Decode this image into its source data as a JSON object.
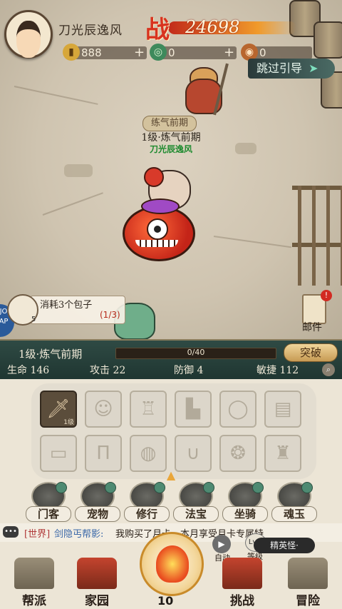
{
  "player": {
    "name": "刀光辰逸风",
    "power_icon": "战",
    "power": "24698"
  },
  "resources": [
    {
      "icon": "ticket-icon",
      "value": "888"
    },
    {
      "icon": "jade-coin-icon",
      "value": "0"
    },
    {
      "icon": "copper-coin-icon",
      "value": "0"
    }
  ],
  "skip_label": "跳过引导",
  "scene": {
    "realm_badge": "练气前期",
    "level_label": "1级·炼气前期",
    "character_name": "刀光辰逸风"
  },
  "quest": {
    "text": "消耗3个包子",
    "progress": "(1/3)",
    "count": "5"
  },
  "mail": {
    "label": "邮件",
    "badge": "!"
  },
  "side_badge": "JO\nAP",
  "panel": {
    "level_title": "1级·炼气前期",
    "xp": "0/40",
    "xp_fraction": 0,
    "breakthrough": "突破",
    "stats": {
      "hp": "生命 146",
      "atk": "攻击 22",
      "def": "防御 4",
      "agi": "敏捷 112"
    },
    "slots": [
      {
        "icon": "sword-icon",
        "filled": true,
        "level": "1级"
      },
      {
        "icon": "face-icon",
        "filled": false
      },
      {
        "icon": "robe-icon",
        "filled": false
      },
      {
        "icon": "boots-icon",
        "filled": false
      },
      {
        "icon": "bracelet-icon",
        "filled": false
      },
      {
        "icon": "cloth-icon",
        "filled": false
      },
      {
        "icon": "belt-icon",
        "filled": false
      },
      {
        "icon": "pants-icon",
        "filled": false
      },
      {
        "icon": "ring-icon",
        "filled": false
      },
      {
        "icon": "necklace-icon",
        "filled": false
      },
      {
        "icon": "jade-pendant-icon",
        "filled": false
      },
      {
        "icon": "armor-icon",
        "filled": false
      }
    ],
    "tabs": [
      "门客",
      "宠物",
      "修行",
      "法宝",
      "坐骑",
      "魂玉"
    ]
  },
  "world_chat": {
    "tag": "[世界]",
    "name": "剑隐丐帮影:",
    "message": "我购买了月卡，本月享受月卡专属特"
  },
  "elite_label": "精英怪·",
  "auto": {
    "label": "自动"
  },
  "lvtag": {
    "circle": "Lv.1",
    "label": "等级"
  },
  "fight_count": "10",
  "nav": [
    "帮派",
    "家园",
    "挑战",
    "冒险"
  ],
  "colors": {
    "panel_dark": "#1f3631",
    "accent": "#d8331f",
    "name_green": "#1d8a2e"
  }
}
